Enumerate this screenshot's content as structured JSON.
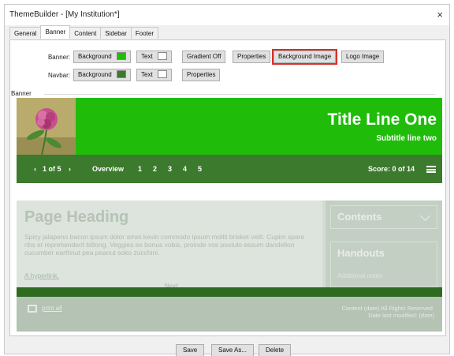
{
  "window": {
    "title": "ThemeBuilder - [My Institution*]",
    "close_glyph": "×"
  },
  "tabs": [
    "General",
    "Banner",
    "Content",
    "Sidebar",
    "Footer"
  ],
  "banner_row": {
    "label": "Banner:",
    "background_label": "Background",
    "background_color": "#1fbd0a",
    "text_label": "Text",
    "text_color": "#ffffff",
    "gradient_label": "Gradient Off",
    "properties_label": "Properties",
    "bg_image_label": "Background Image",
    "logo_image_label": "Logo Image"
  },
  "navbar_row": {
    "label": "Navbar:",
    "background_label": "Background",
    "background_color": "#3c7a2d",
    "text_label": "Text",
    "text_color": "#ffffff",
    "properties_label": "Properties"
  },
  "group_label": "Banner",
  "preview": {
    "title_line_one": "Title Line One",
    "subtitle": "Subtitle line two",
    "nav_counter": "1 of 5",
    "nav_overview": "Overview",
    "nav_pages": [
      "1",
      "2",
      "3",
      "4",
      "5"
    ],
    "score": "Score: 0 of 14",
    "page_heading": "Page Heading",
    "paragraph": "Spicy jalapeno bacon ipsum dolor amet kevin commodo ipsum mollit brisket velit. Cupim spare ribs et reprehenderit biltong. Veggies es bonus vobis, proinde vos postulo essum dandelion cucumber earthnut pea peanut soko zucchini.",
    "hyperlink": "A hyperlink.",
    "next_label": "Next",
    "contents_label": "Contents",
    "handouts_label": "Handouts",
    "handouts_note": "Additional notes",
    "print_label": "print all",
    "footer_line1": "Content (date) All Rights Reserved.",
    "footer_line2": "Date last modified: (date)"
  },
  "bottom_buttons": {
    "save": "Save",
    "save_as": "Save As...",
    "delete": "Delete"
  }
}
